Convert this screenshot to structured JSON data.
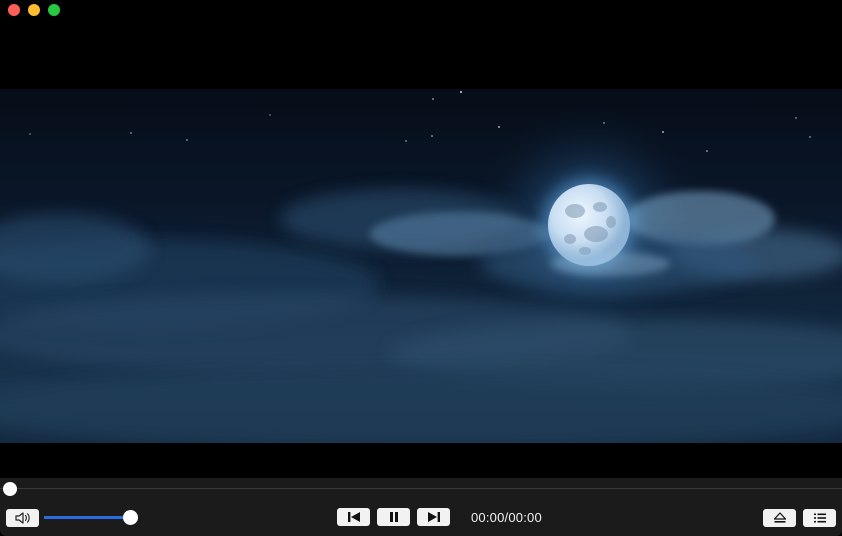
{
  "window": {
    "controls": [
      "close",
      "minimize",
      "maximize"
    ]
  },
  "video": {
    "scene": "moon-over-clouds"
  },
  "player": {
    "progress_fraction": 0.0,
    "volume_fraction": 1.0,
    "time_display": "00:00/00:00",
    "accent_color": "#2d6be0",
    "icons": {
      "volume": "speaker-icon",
      "previous": "skip-back-icon",
      "pause": "pause-icon",
      "next": "skip-forward-icon",
      "eject": "eject-icon",
      "playlist": "list-icon"
    }
  }
}
